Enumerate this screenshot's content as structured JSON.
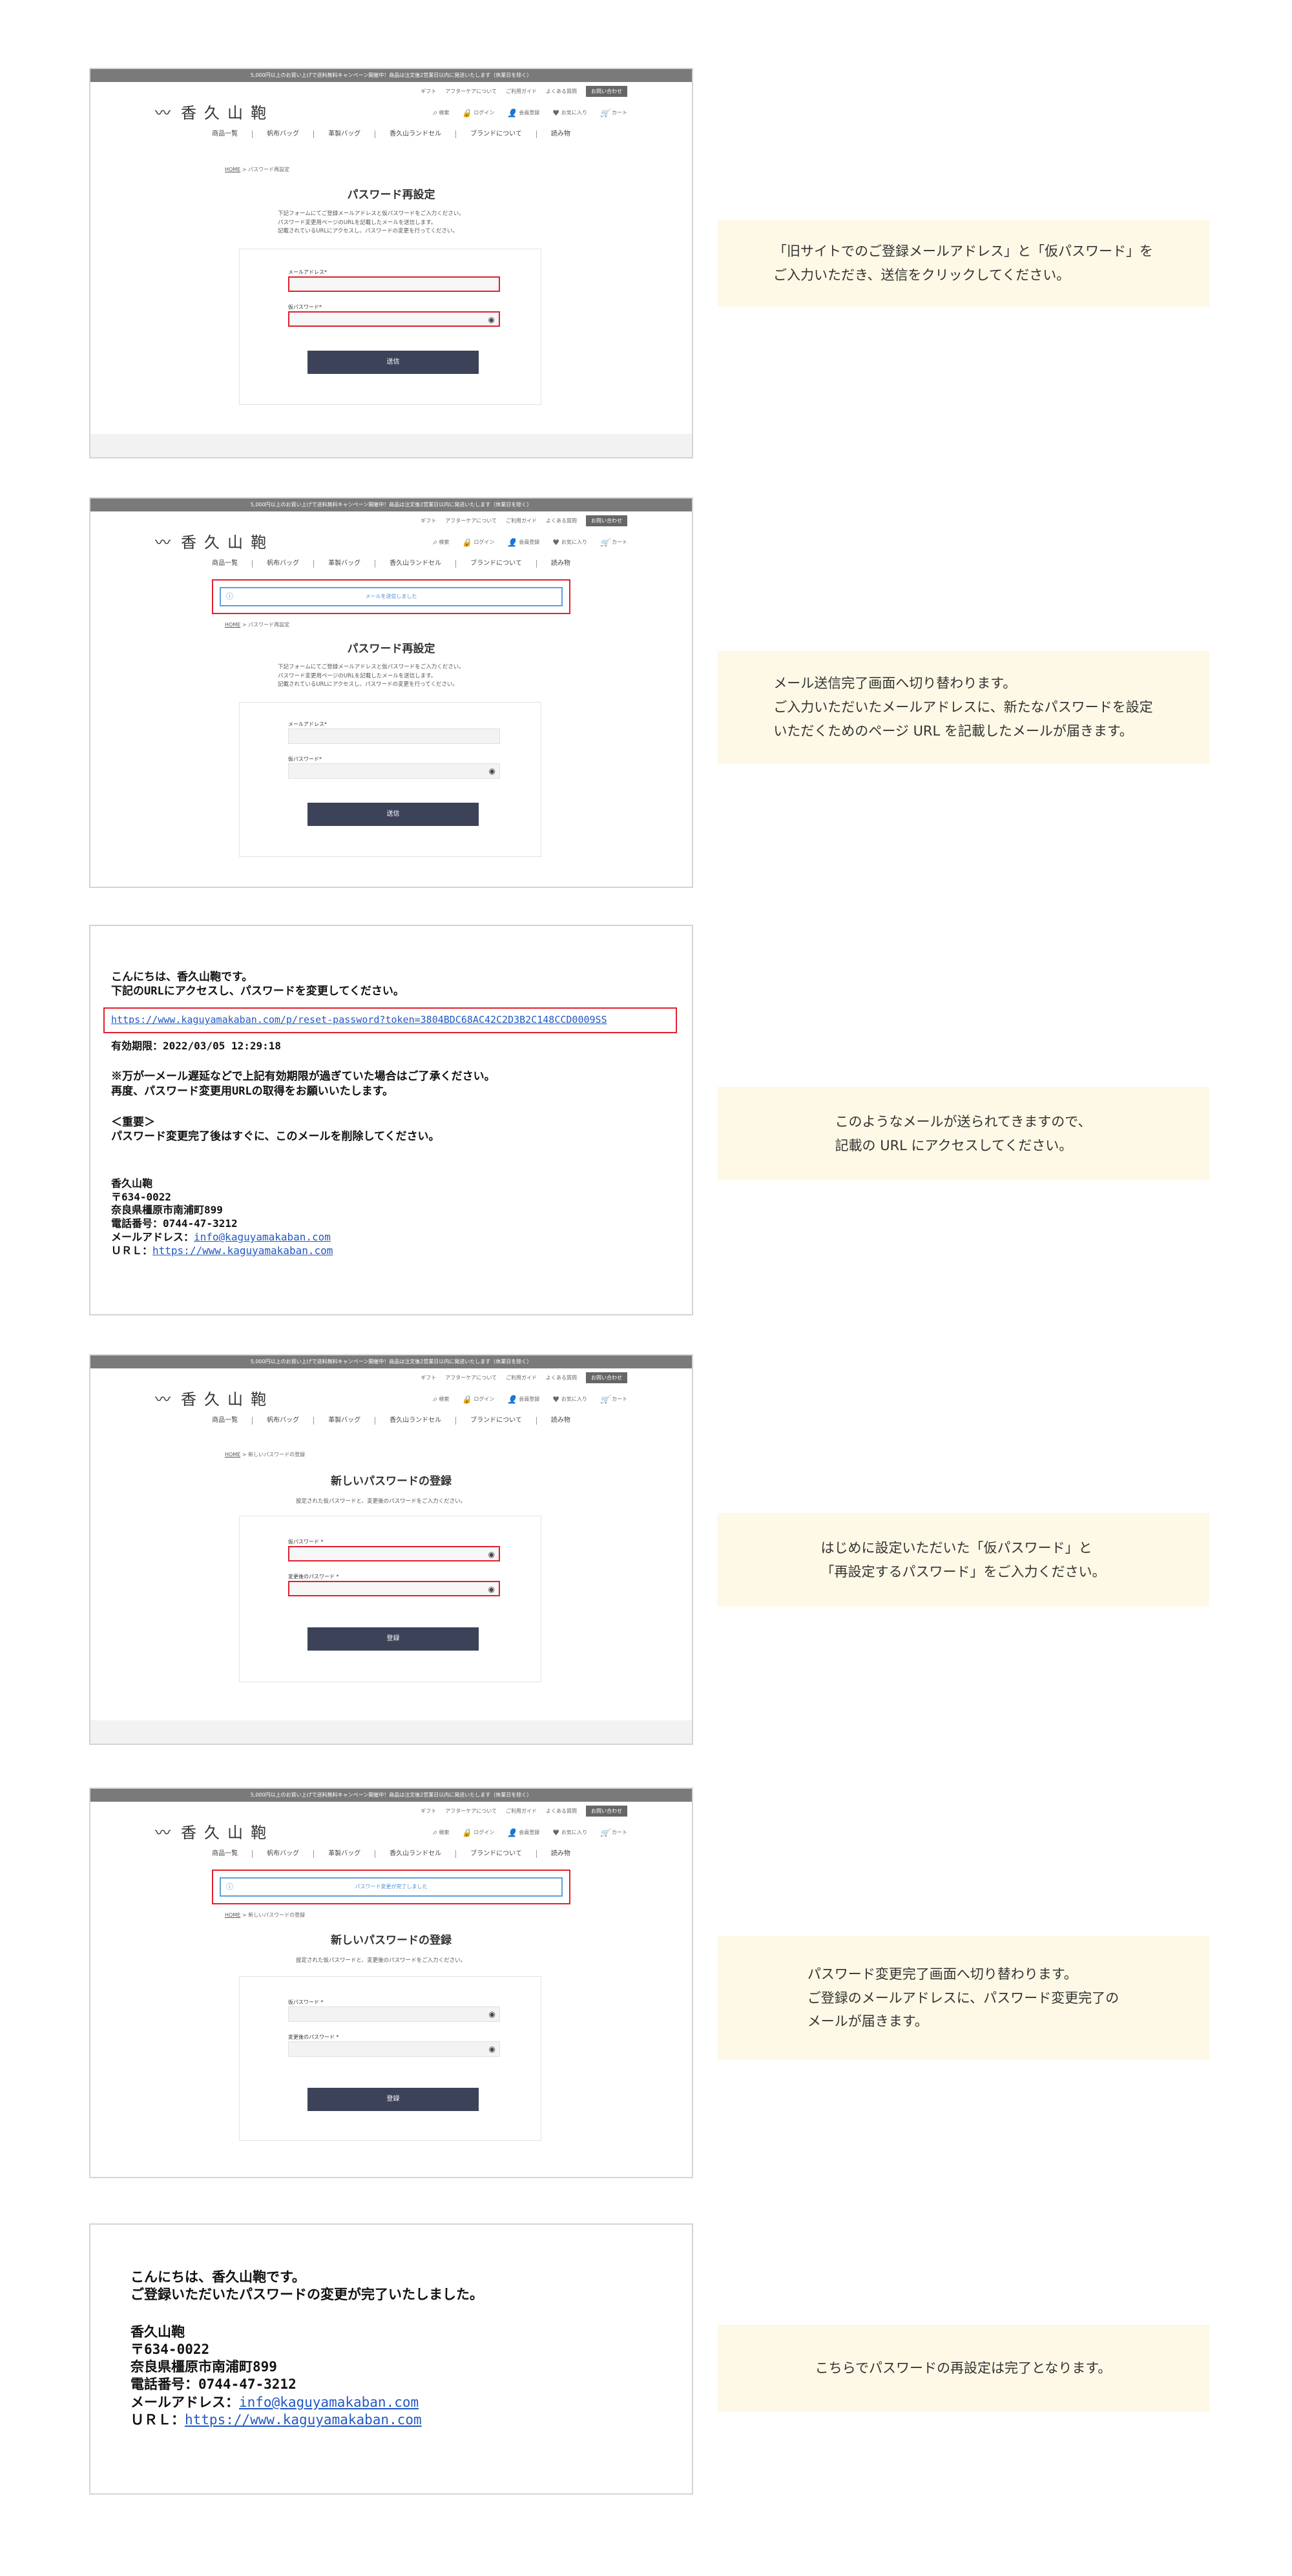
{
  "site": {
    "topbar": "5,000円以上のお買い上げで送料無料キャンペーン開催中！商品は注文後2営業日以内に発送いたします（休業日を除く）",
    "util": [
      "ギフト",
      "アフターケアについて",
      "ご利用ガイド",
      "よくある質問"
    ],
    "contact": "お問い合わせ",
    "logo_mark": "〰",
    "logo_name": "香久山鞄",
    "icons": {
      "search": "検索",
      "login": "ログイン",
      "register": "会員登録",
      "favorite": "お気に入り",
      "cart": "カート",
      "cart_count": "0"
    },
    "gnav": [
      "商品一覧",
      "帆布バッグ",
      "革製バッグ",
      "香久山ランドセル",
      "ブランドについて",
      "読み物"
    ]
  },
  "step1": {
    "crumb_home": "HOME",
    "crumb_current": " > パスワード再設定",
    "title": "パスワード再設定",
    "desc": "下記フォームにてご登録メールアドレスと仮パスワードをご入力ください。\nパスワード変更用ページのURLを記載したメールを送信します。\n記載されているURLにアクセスし、パスワードの変更を行ってください。",
    "label_email": "メールアドレス*",
    "label_temp": "仮パスワード*",
    "button": "送信",
    "note": "「旧サイトでのご登録メールアドレス」と「仮パスワード」を\nご入力いただき、送信をクリックしてください。"
  },
  "step2": {
    "alert": "メールを送信しました",
    "crumb_home": "HOME",
    "crumb_current": " > パスワード再設定",
    "title": "パスワード再設定",
    "desc": "下記フォームにてご登録メールアドレスと仮パスワードをご入力ください。\nパスワード変更用ページのURLを記載したメールを送信します。\n記載されているURLにアクセスし、パスワードの変更を行ってください。",
    "label_email": "メールアドレス*",
    "label_temp": "仮パスワード*",
    "button": "送信",
    "note": "メール送信完了画面へ切り替わります。\nご入力いただいたメールアドレスに、新たなパスワードを設定\nいただくためのページ URL を記載したメールが届きます。"
  },
  "mail1": {
    "greeting": "こんにちは、香久山鞄です。\n下記のURLにアクセスし、パスワードを変更してください。",
    "url": "https://www.kaguyamakaban.com/p/reset-password?token=3804BDC68AC42C2D3B2C148CCD0009SS",
    "expiry": "有効期限：2022/03/05 12:29:18",
    "warning": "※万が一メール遅延などで上記有効期限が過ぎていた場合はご了承ください。\n再度、パスワード変更用URLの取得をお願いいたします。",
    "important": "＜重要＞\nパスワード変更完了後はすぐに、このメールを削除してください。",
    "sign": "香久山鞄\n〒634-0022\n奈良県橿原市南浦町899\n電話番号：0744-47-3212",
    "mail_label": "メールアドレス：",
    "mail_value": "info@kaguyamakaban.com",
    "url_label": "ＵＲＬ：",
    "url_value": "https://www.kaguyamakaban.com",
    "note": "このようなメールが送られてきますので、\n記載の URL にアクセスしてください。"
  },
  "step3": {
    "crumb_home": "HOME",
    "crumb_current": " > 新しいパスワードの登録",
    "title": "新しいパスワードの登録",
    "desc": "設定された仮パスワードと、変更後のパスワードをご入力ください。",
    "label_temp": "仮パスワード *",
    "label_new": "変更後のパスワード *",
    "button": "登録",
    "note": "はじめに設定いただいた「仮パスワード」と\n「再設定するパスワード」をご入力ください。"
  },
  "step4": {
    "alert": "パスワード変更が完了しました",
    "crumb_home": "HOME",
    "crumb_current": " > 新しいパスワードの登録",
    "title": "新しいパスワードの登録",
    "desc": "設定された仮パスワードと、変更後のパスワードをご入力ください。",
    "label_temp": "仮パスワード *",
    "label_new": "変更後のパスワード *",
    "button": "登録",
    "note": "パスワード変更完了画面へ切り替わります。\nご登録のメールアドレスに、パスワード変更完了の\nメールが届きます。"
  },
  "mail2": {
    "greeting": "こんにちは、香久山鞄です。\nご登録いただいたパスワードの変更が完了いたしました。",
    "sign": "香久山鞄\n〒634-0022\n奈良県橿原市南浦町899\n電話番号：0744-47-3212",
    "mail_label": "メールアドレス：",
    "mail_value": "info@kaguyamakaban.com",
    "url_label": "ＵＲＬ：",
    "url_value": "https://www.kaguyamakaban.com",
    "note": "こちらでパスワードの再設定は完了となります。"
  }
}
